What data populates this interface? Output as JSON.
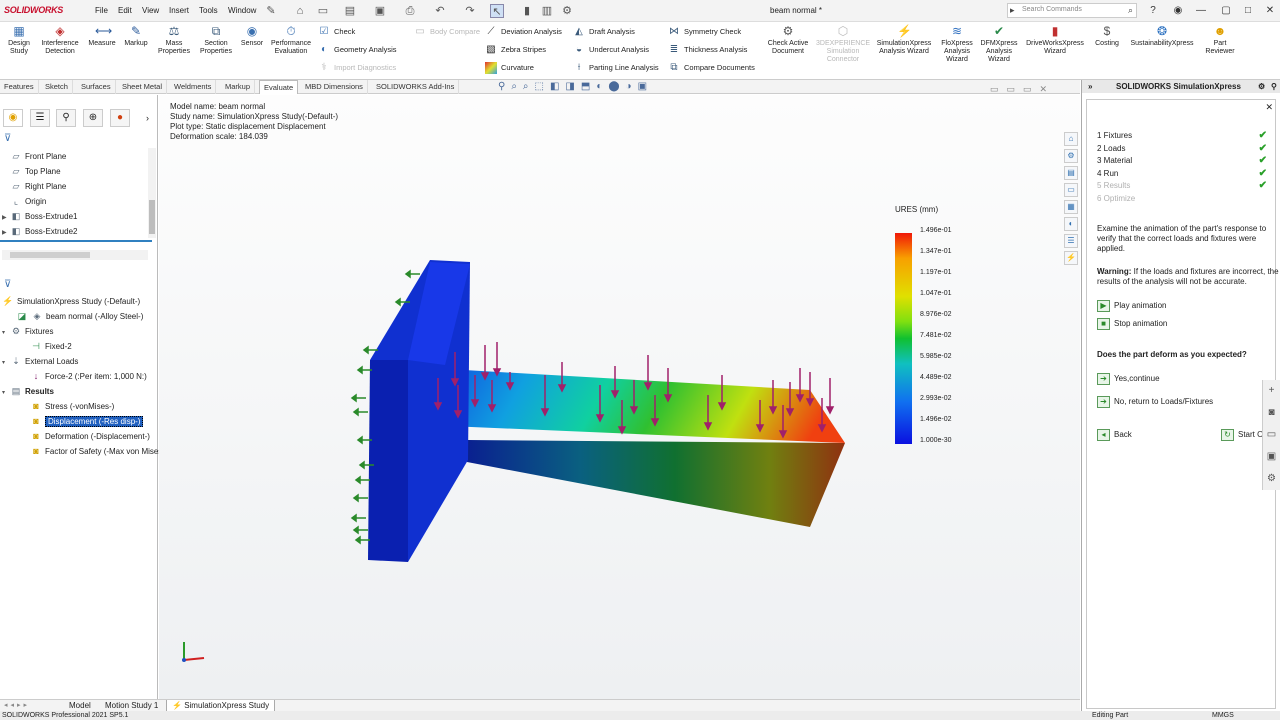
{
  "app": {
    "logo": "SOLIDWORKS",
    "doc_title": "beam normal *"
  },
  "menu": [
    "File",
    "Edit",
    "View",
    "Insert",
    "Tools",
    "Window"
  ],
  "search": {
    "placeholder": "Search Commands"
  },
  "ribbon": {
    "big": [
      {
        "label": "Design\nStudy",
        "icon": "design-study-icon"
      },
      {
        "label": "Interference\nDetection",
        "icon": "interference-icon"
      },
      {
        "label": "Measure",
        "icon": "measure-icon"
      },
      {
        "label": "Markup",
        "icon": "markup-icon"
      },
      {
        "label": "Mass\nProperties",
        "icon": "mass-icon"
      },
      {
        "label": "Section\nProperties",
        "icon": "section-icon"
      },
      {
        "label": "Sensor",
        "icon": "sensor-icon"
      },
      {
        "label": "Performance\nEvaluation",
        "icon": "performance-icon"
      }
    ],
    "small1": [
      "Check",
      "Geometry Analysis",
      "Import Diagnostics"
    ],
    "body_compare": "Body Compare",
    "small2": [
      "Deviation Analysis",
      "Zebra Stripes",
      "Curvature"
    ],
    "small3": [
      "Draft Analysis",
      "Undercut Analysis",
      "Parting Line Analysis"
    ],
    "small4": [
      "Symmetry Check",
      "Thickness Analysis",
      "Compare Documents"
    ],
    "big2": [
      {
        "label": "Check Active\nDocument",
        "dim": false
      },
      {
        "label": "3DEXPERIENCE\nSimulation\nConnector",
        "dim": true
      },
      {
        "label": "SimulationXpress\nAnalysis Wizard",
        "dim": false
      },
      {
        "label": "FloXpress\nAnalysis\nWizard",
        "dim": false
      },
      {
        "label": "DFMXpress\nAnalysis\nWizard",
        "dim": false
      },
      {
        "label": "DriveWorksXpress\nWizard",
        "dim": false
      },
      {
        "label": "Costing",
        "dim": false
      },
      {
        "label": "SustainabilityXpress",
        "dim": false
      },
      {
        "label": "Part\nReviewer",
        "dim": false
      }
    ]
  },
  "cmd_tabs": [
    "Features",
    "Sketch",
    "Surfaces",
    "Sheet Metal",
    "Weldments",
    "Markup",
    "Evaluate",
    "MBD Dimensions",
    "SOLIDWORKS Add-Ins"
  ],
  "active_cmd_tab": "Evaluate",
  "tree_top": [
    "Front Plane",
    "Top Plane",
    "Right Plane",
    "Origin",
    "Boss-Extrude1",
    "Boss-Extrude2"
  ],
  "sim_tree": {
    "study": "SimulationXpress Study (-Default-)",
    "part": "beam normal (-Alloy Steel-)",
    "fixtures": "Fixtures",
    "fixed": "Fixed-2",
    "external_loads": "External Loads",
    "force": "Force-2 (:Per item: 1,000 N:)",
    "results": "Results",
    "stress": "Stress (-vonMises-)",
    "displacement": "Displacement (-Res disp-)",
    "deformation": "Deformation (-Displacement-)",
    "fos": "Factor of Safety (-Max von Mises-)"
  },
  "model_info": [
    "Model name: beam normal",
    "Study name: SimulationXpress Study(-Default-)",
    "Plot type: Static displacement Displacement",
    "Deformation scale: 184.039"
  ],
  "legend": {
    "title": "URES (mm)",
    "ticks": [
      "1.496e-01",
      "1.347e-01",
      "1.197e-01",
      "1.047e-01",
      "8.976e-02",
      "7.481e-02",
      "5.985e-02",
      "4.489e-02",
      "2.993e-02",
      "1.496e-02",
      "1.000e-30"
    ],
    "colors": {
      "max": "#f01808",
      "mid": "#10c030",
      "min": "#0a10e0"
    }
  },
  "bottom_tabs": [
    "Model",
    "Motion Study 1",
    "SimulationXpress Study"
  ],
  "status": {
    "left": "SOLIDWORKS Professional 2021 SP5.1",
    "mode": "Editing Part",
    "units": "MMGS"
  },
  "right_panel": {
    "title": "SOLIDWORKS SimulationXpress",
    "steps": [
      {
        "n": "1",
        "label": "Fixtures",
        "done": true
      },
      {
        "n": "2",
        "label": "Loads",
        "done": true
      },
      {
        "n": "3",
        "label": "Material",
        "done": true
      },
      {
        "n": "4",
        "label": "Run",
        "done": true
      },
      {
        "n": "5",
        "label": "Results",
        "done": true
      },
      {
        "n": "6",
        "label": "Optimize",
        "done": false
      }
    ],
    "instruction": "Examine the animation of the part's response to verify that the correct loads and fixtures were applied.",
    "warning_label": "Warning:",
    "warning_text": "If the loads and fixtures are incorrect, the results of the analysis will not be accurate.",
    "play": "Play animation",
    "stop": "Stop animation",
    "question": "Does the part deform as you expected?",
    "yes": "Yes,continue",
    "no": "No, return to Loads/Fixtures",
    "back": "Back",
    "start_over": "Start Over"
  }
}
